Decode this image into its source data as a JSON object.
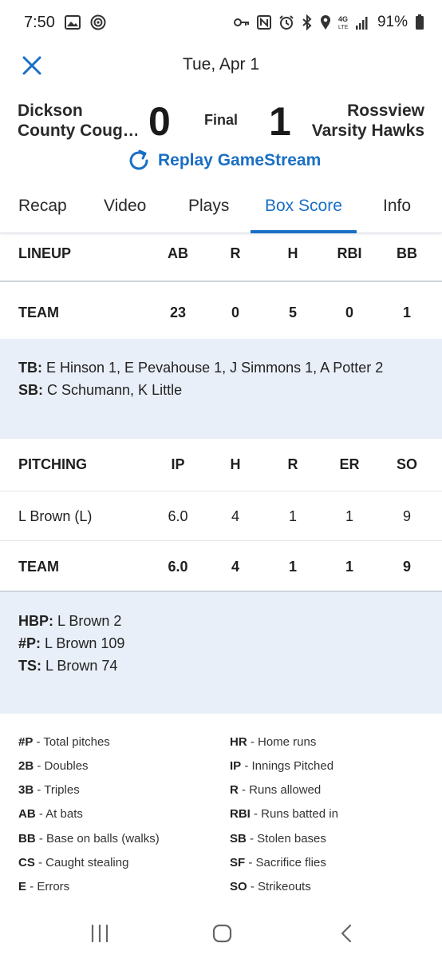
{
  "status_bar": {
    "time": "7:50",
    "battery": "91%",
    "network": "4G LTE",
    "icons": [
      "image-icon",
      "podcast-icon",
      "key-icon",
      "nfc-icon",
      "alarm-icon",
      "bluetooth-icon",
      "location-icon",
      "signal-icon",
      "battery-icon"
    ]
  },
  "header": {
    "date": "Tue, Apr 1",
    "close_icon": "close-icon"
  },
  "game": {
    "home_team_line1": "Dickson",
    "home_team_line2": "County Coug…",
    "home_score": "0",
    "status": "Final",
    "away_score": "1",
    "away_team_line1": "Rossview",
    "away_team_line2": "Varsity Hawks",
    "replay_label": "Replay GameStream"
  },
  "tabs": [
    {
      "label": "Recap"
    },
    {
      "label": "Video"
    },
    {
      "label": "Plays"
    },
    {
      "label": "Box Score",
      "active": true
    },
    {
      "label": "Info"
    }
  ],
  "lineup": {
    "headers": [
      "LINEUP",
      "AB",
      "R",
      "H",
      "RBI",
      "BB"
    ],
    "team_row": [
      "TEAM",
      "23",
      "0",
      "5",
      "0",
      "1"
    ]
  },
  "batting_notes": [
    {
      "key": "TB:",
      "value": " E Hinson 1, E Pevahouse 1, J Simmons 1, A Potter 2"
    },
    {
      "key": "SB:",
      "value": " C Schumann, K Little"
    }
  ],
  "pitching": {
    "headers": [
      "PITCHING",
      "IP",
      "H",
      "R",
      "ER",
      "SO"
    ],
    "rows": [
      [
        "L Brown (L)",
        "6.0",
        "4",
        "1",
        "1",
        "9"
      ]
    ],
    "team_row": [
      "TEAM",
      "6.0",
      "4",
      "1",
      "1",
      "9"
    ]
  },
  "pitching_notes": [
    {
      "key": "HBP:",
      "value": " L Brown 2"
    },
    {
      "key": "#P:",
      "value": " L Brown 109"
    },
    {
      "key": "TS:",
      "value": " L Brown 74"
    }
  ],
  "glossary": {
    "left": [
      {
        "abbr": "#P",
        "desc": " - Total pitches"
      },
      {
        "abbr": "2B",
        "desc": " - Doubles"
      },
      {
        "abbr": "3B",
        "desc": " - Triples"
      },
      {
        "abbr": "AB",
        "desc": " - At bats"
      },
      {
        "abbr": "BB",
        "desc": " - Base on balls (walks)"
      },
      {
        "abbr": "CS",
        "desc": " - Caught stealing"
      },
      {
        "abbr": "E",
        "desc": " - Errors"
      }
    ],
    "right": [
      {
        "abbr": "HR",
        "desc": " - Home runs"
      },
      {
        "abbr": "IP",
        "desc": " - Innings Pitched"
      },
      {
        "abbr": "R",
        "desc": " - Runs allowed"
      },
      {
        "abbr": "RBI",
        "desc": " - Runs batted in"
      },
      {
        "abbr": "SB",
        "desc": " - Stolen bases"
      },
      {
        "abbr": "SF",
        "desc": " - Sacrifice flies"
      },
      {
        "abbr": "SO",
        "desc": " - Strikeouts"
      }
    ]
  },
  "nav_bar": {
    "icons": [
      "recent-apps-icon",
      "home-icon",
      "back-icon"
    ]
  },
  "colors": {
    "accent": "#1a6fc4",
    "notes_background": "#e9eff8"
  }
}
